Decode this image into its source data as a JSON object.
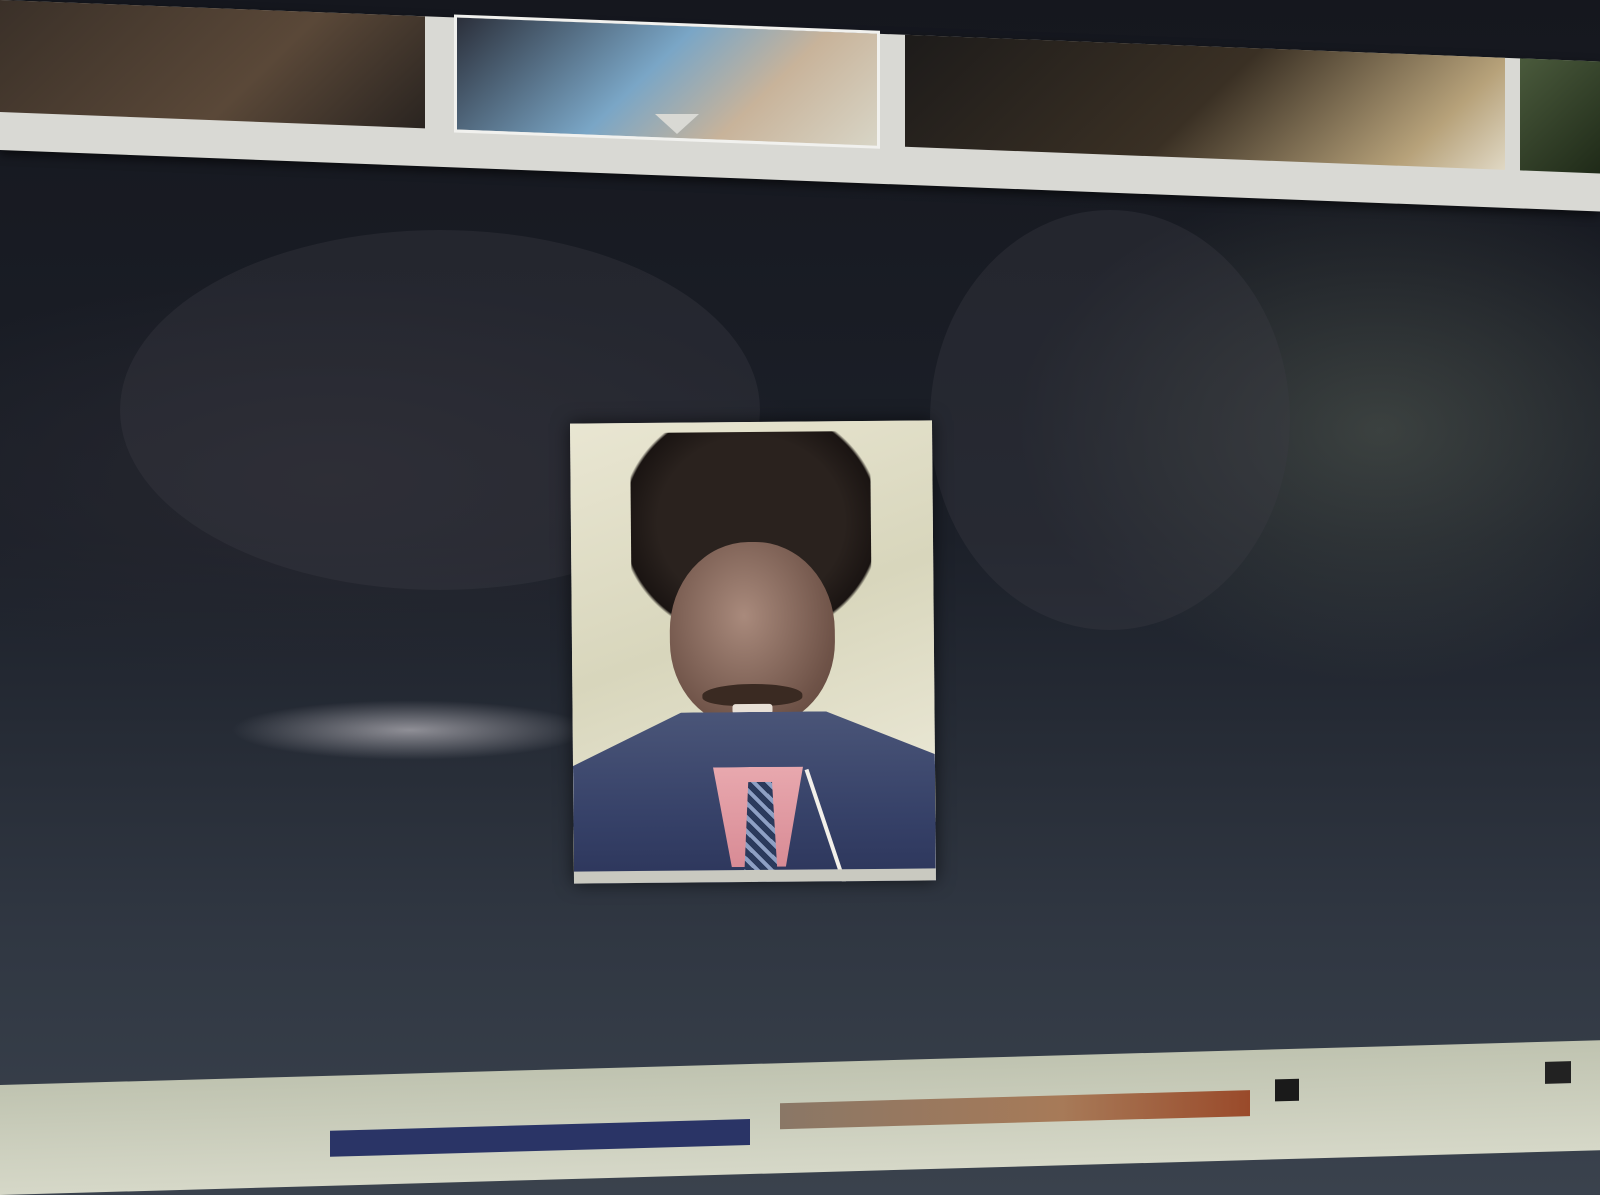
{
  "filmstrip": {
    "thumbnails": [
      {
        "label": "",
        "selected": false
      },
      {
        "label": "",
        "selected": true
      },
      {
        "label": "",
        "selected": false
      },
      {
        "label": "",
        "selected": false
      }
    ]
  },
  "viewer": {
    "photo_caption": ""
  },
  "dock": {
    "items": [
      "",
      "",
      "",
      ""
    ]
  },
  "colors": {
    "background": "#1b1e27",
    "filmstrip": "#d9d9d4",
    "dock": "#d6d8c8",
    "accent_blue": "#2a3466"
  }
}
